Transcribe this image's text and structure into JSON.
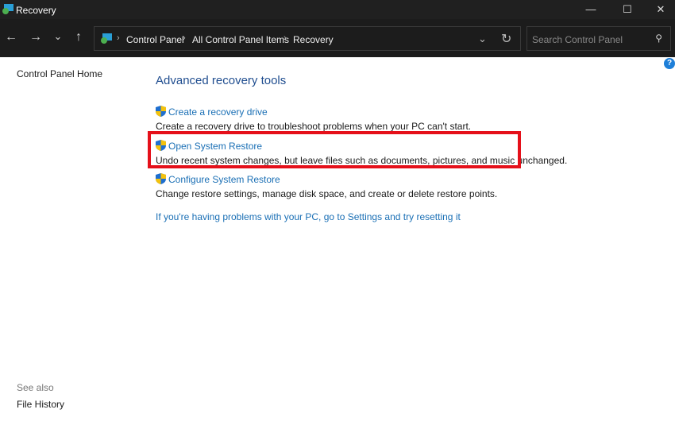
{
  "window": {
    "title": "Recovery",
    "minimize": "—",
    "maximize": "☐",
    "close": "✕"
  },
  "nav": {
    "back": "←",
    "forward": "→",
    "recent": "⌄",
    "up": "↑",
    "dropdown": "⌄",
    "refresh": "↻"
  },
  "breadcrumb": [
    "Control Panel",
    "All Control Panel Items",
    "Recovery"
  ],
  "search": {
    "placeholder": "Search Control Panel"
  },
  "help": "?",
  "sidebar": {
    "home": "Control Panel Home",
    "see_also": "See also",
    "file_history": "File History"
  },
  "main": {
    "heading": "Advanced recovery tools",
    "items": [
      {
        "link": "Create a recovery drive",
        "desc": "Create a recovery drive to troubleshoot problems when your PC can't start."
      },
      {
        "link": "Open System Restore",
        "desc": "Undo recent system changes, but leave files such as documents, pictures, and music unchanged."
      },
      {
        "link": "Configure System Restore",
        "desc": "Change restore settings, manage disk space, and create or delete restore points."
      }
    ],
    "settings_link": "If you're having problems with your PC, go to Settings and try resetting it"
  },
  "highlight_color": "#e5101a"
}
